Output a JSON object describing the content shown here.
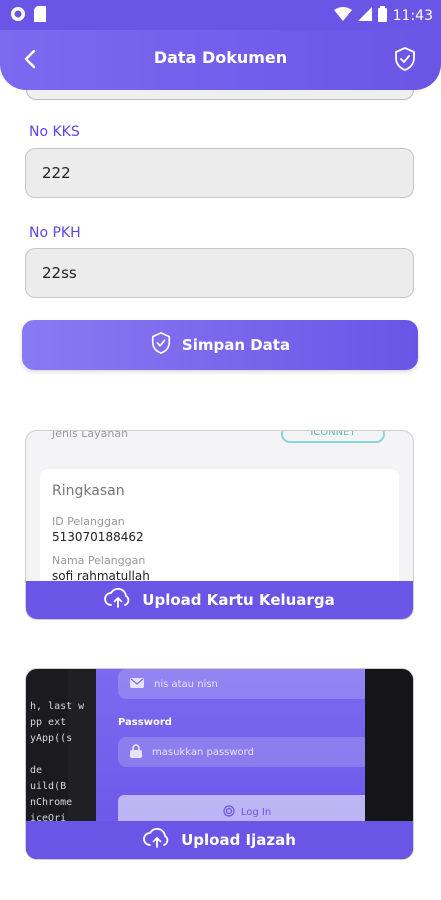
{
  "status": {
    "time": "11:43"
  },
  "appbar": {
    "title": "Data Dokumen"
  },
  "fields": {
    "kks": {
      "label": "No KKS",
      "value": "222"
    },
    "pkh": {
      "label": "No PKH",
      "value": "22ss"
    }
  },
  "buttons": {
    "save": "Simpan Data"
  },
  "card_kk": {
    "upload_label": "Upload Kartu Keluarga",
    "header_label": "Jenis Layanan",
    "pill": "ICONNET",
    "section_title": "Ringkasan",
    "items": [
      {
        "key": "ID Pelanggan",
        "value": "513070188462"
      },
      {
        "key": "Nama Pelanggan",
        "value": "sofi rahmatullah"
      }
    ]
  },
  "card_ijazah": {
    "upload_label": "Upload Ijazah",
    "code_text": "h, last w\npp ext\nyApp((s\n\nde\nuild(B\nnChrome\niceOri",
    "field1_placeholder": "nis atau nisn",
    "password_label": "Password",
    "field2_placeholder": "masukkan password",
    "login_label": "Log In"
  },
  "colors": {
    "primary": "#6a55e6",
    "label": "#5b48e6",
    "field_bg": "#ececec"
  }
}
